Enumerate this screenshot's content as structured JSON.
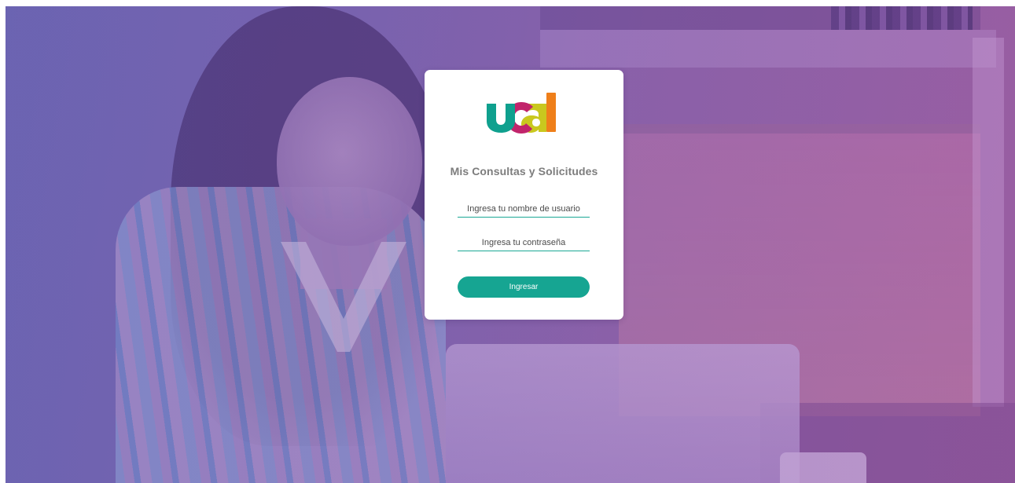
{
  "brand": {
    "logo_text": "ucal",
    "colors": {
      "u": "#0fa08e",
      "c": "#c1246b",
      "a": "#c9c81e",
      "l": "#ef7f1a"
    }
  },
  "login": {
    "title": "Mis Consultas y Solicitudes",
    "username_placeholder": "Ingresa tu nombre de usuario",
    "password_placeholder": "Ingresa tu contraseña",
    "submit_label": "Ingresar"
  },
  "theme": {
    "accent": "#16a592",
    "background_tint": "#7a64b0"
  }
}
